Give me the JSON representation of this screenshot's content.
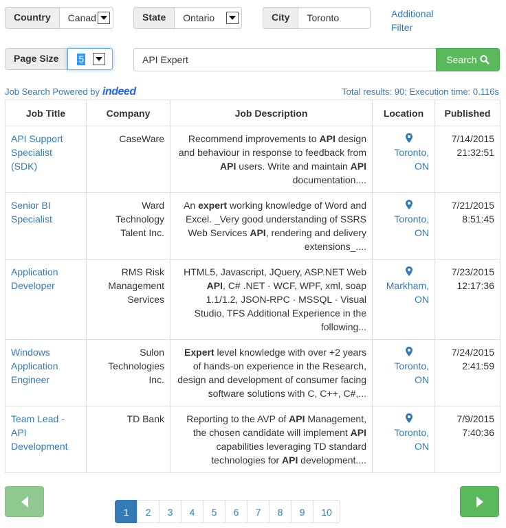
{
  "filters": {
    "country": {
      "label": "Country",
      "value": "Canada"
    },
    "state": {
      "label": "State",
      "value": "Ontario"
    },
    "city": {
      "label": "City",
      "value": "Toronto"
    },
    "additional_filter": "Additional Filter",
    "page_size": {
      "label": "Page Size",
      "value": "5"
    }
  },
  "search": {
    "query": "API Expert",
    "button_label": "Search"
  },
  "powered_by": {
    "text": "Job Search Powered by",
    "brand": "indeed"
  },
  "stats": "Total results: 90; Execution time: 0.116s",
  "table": {
    "headers": {
      "title": "Job Title",
      "company": "Company",
      "description": "Job Description",
      "location": "Location",
      "published": "Published"
    },
    "rows": [
      {
        "title": "API Support Specialist (SDK)",
        "company": "CaseWare",
        "description": "Recommend improvements to **API** design and behaviour in response to feedback from **API** users. Write and maintain **API** documentation....",
        "city": "Toronto,",
        "province": "ON",
        "date": "7/14/2015",
        "time": "21:32:51"
      },
      {
        "title": "Senior BI Specialist",
        "company": "Ward Technology Talent Inc.",
        "description": "An **expert** working knowledge of Word and Excel. _Very good understanding of SSRS Web Services **API**, rendering and delivery extensions_....",
        "city": "Toronto,",
        "province": "ON",
        "date": "7/21/2015",
        "time": "8:51:45"
      },
      {
        "title": "Application Developer",
        "company": "RMS Risk Management Services",
        "description": "HTML5, Javascript, JQuery, ASP.NET Web **API**, C# .NET · WCF, WPF, xml, soap 1.1/1.2, JSON-RPC · MSSQL · Visual Studio, TFS Additional Experience in the following...",
        "city": "Markham,",
        "province": "ON",
        "date": "7/23/2015",
        "time": "12:17:36"
      },
      {
        "title": "Windows Application Engineer",
        "company": "Sulon Technologies Inc.",
        "description": "**Expert** level knowledge with over +2 years of hands-on experience in the Research, design and development of consumer facing software solutions with C, C++, C#,...",
        "city": "Toronto,",
        "province": "ON",
        "date": "7/24/2015",
        "time": "2:41:59"
      },
      {
        "title": "Team Lead - API Development",
        "company": "TD Bank",
        "description": "Reporting to the AVP of **API** Management, the chosen candidate will implement **API** capabilities leveraging TD standard technologies for **API** development....",
        "city": "Toronto,",
        "province": "ON",
        "date": "7/9/2015",
        "time": "7:40:36"
      }
    ]
  },
  "pagination": {
    "pages": [
      "1",
      "2",
      "3",
      "4",
      "5",
      "6",
      "7",
      "8",
      "9",
      "10"
    ],
    "current": "1"
  },
  "colors": {
    "link": "#337ab7",
    "success": "#5cb85c",
    "success_light": "#8fc98f",
    "brand": "#2164f3"
  }
}
